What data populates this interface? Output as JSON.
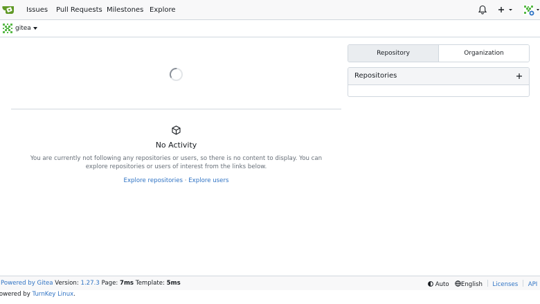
{
  "navbar": {
    "links": [
      "Issues",
      "Pull Requests",
      "Milestones",
      "Explore"
    ]
  },
  "context": {
    "user_name": "gitea"
  },
  "feed": {
    "empty_title": "No Activity",
    "empty_description": "You are currently not following any repositories or users, so there is no content to display. You can explore repositories or users of interest from the links below.",
    "explore_repos_link": "Explore repositories",
    "separator": "·",
    "explore_users_link": "Explore users"
  },
  "sidebar": {
    "tabs": [
      {
        "label": "Repository",
        "active": true
      },
      {
        "label": "Organization",
        "active": false
      }
    ],
    "repos_title": "Repositories"
  },
  "footer": {
    "powered_by": "Powered by Gitea",
    "version_label": "Version:",
    "version": "1.27.3",
    "page_label": "Page:",
    "page_time": "7ms",
    "template_label": "Template:",
    "template_time": "5ms",
    "theme": "Auto",
    "language": "English",
    "licenses": "Licenses",
    "api": "API",
    "powered_by_turnkey_prefix": "Powered by",
    "turnkey_link": "TurnKey Linux",
    "turnkey_suffix": "."
  },
  "colors": {
    "accent": "#609926",
    "link": "#2f73c4",
    "border": "#d0d7de"
  }
}
